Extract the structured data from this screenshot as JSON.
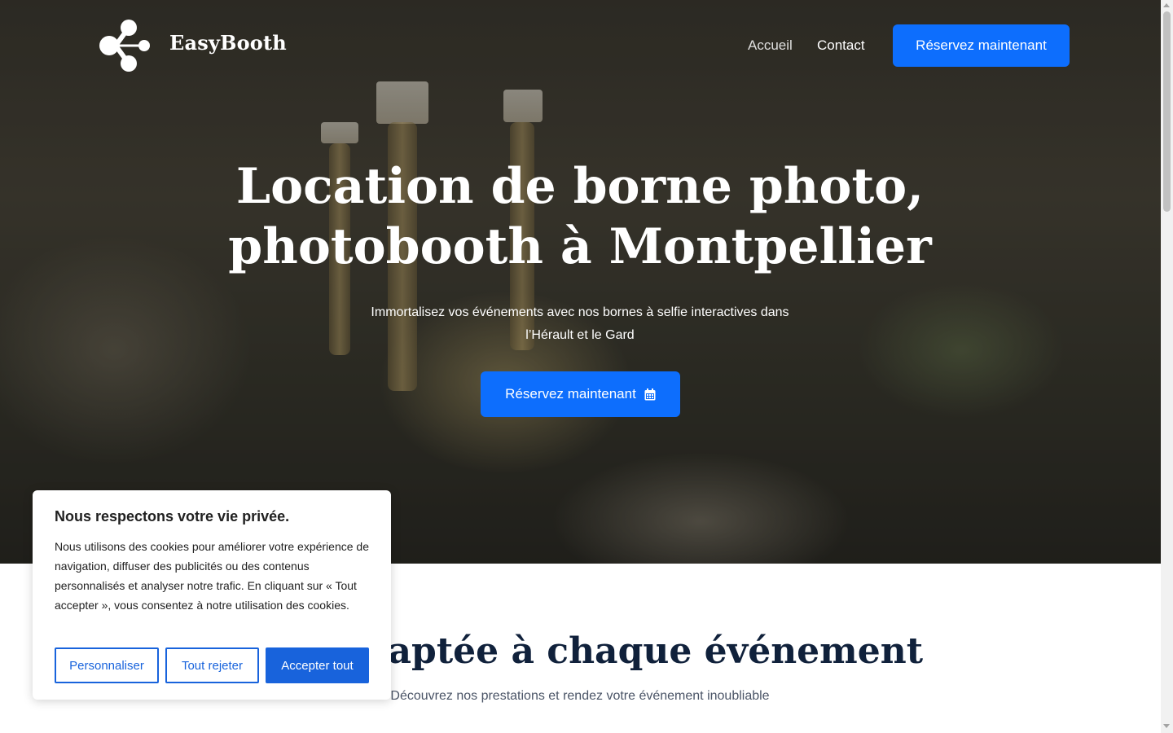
{
  "brand": {
    "name": "EasyBooth",
    "logo_icon": "share-nodes-icon"
  },
  "nav": {
    "links": [
      "Accueil",
      "Contact"
    ],
    "cta_label": "Réservez maintenant"
  },
  "hero": {
    "title_line1": "Location de borne photo,",
    "title_line2": "photobooth à Montpellier",
    "subtitle_line1": "Immortalisez vos événements avec nos bornes à selfie interactives dans",
    "subtitle_line2": "l’Hérault et le Gard",
    "cta_label": "Réservez maintenant",
    "cta_icon": "calendar-icon"
  },
  "section": {
    "title": "hoto adaptée à chaque événement",
    "subtitle": "Découvrez nos prestations et rendez votre événement inoubliable"
  },
  "cookie_banner": {
    "title": "Nous respectons votre vie privée.",
    "text": "Nous utilisons des cookies pour améliorer votre expérience de navigation, diffuser des publicités ou des contenus personnalisés et analyser notre trafic. En cliquant sur « Tout accepter », vous consentez à notre utilisation des cookies.",
    "buttons": {
      "customize": "Personnaliser",
      "reject": "Tout rejeter",
      "accept": "Accepter tout"
    }
  },
  "colors": {
    "primary": "#0d6efd",
    "cookie_accent": "#1863dc",
    "section_title": "#10213b"
  }
}
